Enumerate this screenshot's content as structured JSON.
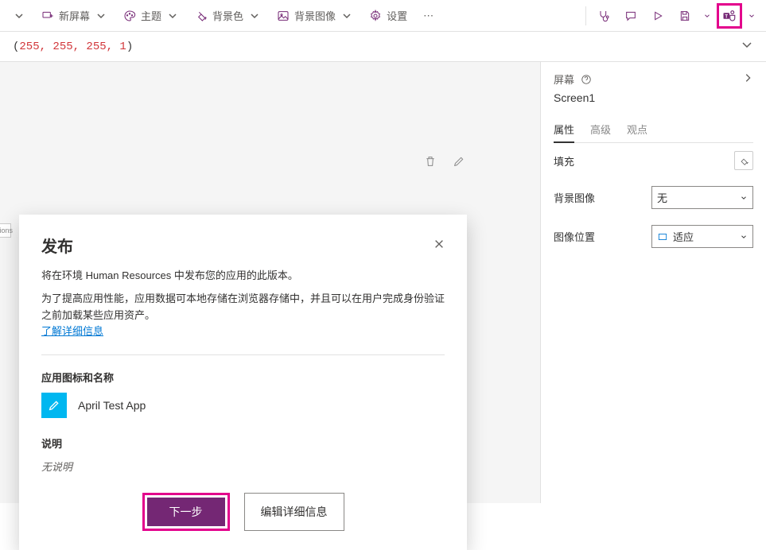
{
  "toolbar": {
    "new_screen": "新屏幕",
    "theme": "主题",
    "bg_color": "背景色",
    "bg_image": "背景图像",
    "settings": "设置"
  },
  "formula": {
    "value": "255,  255,  255,  1"
  },
  "right_panel": {
    "header": "屏幕",
    "title": "Screen1",
    "tabs": {
      "props": "属性",
      "advanced": "高级",
      "view": "观点"
    },
    "fill": "填充",
    "bg_image": "背景图像",
    "bg_image_value": "无",
    "image_position": "图像位置",
    "image_position_value": "适应"
  },
  "dialog": {
    "title": "发布",
    "line1": "将在环境 Human Resources 中发布您的应用的此版本。",
    "line2": "为了提高应用性能，应用数据可本地存储在浏览器存储中，并且可以在用户完成身份验证之前加载某些应用资产。",
    "link": "了解详细信息",
    "icon_section": "应用图标和名称",
    "app_name": "April Test App",
    "desc_section": "说明",
    "desc_value": "无说明",
    "next": "下一步",
    "edit_details": "编辑详细信息"
  },
  "left_stub": "tions"
}
